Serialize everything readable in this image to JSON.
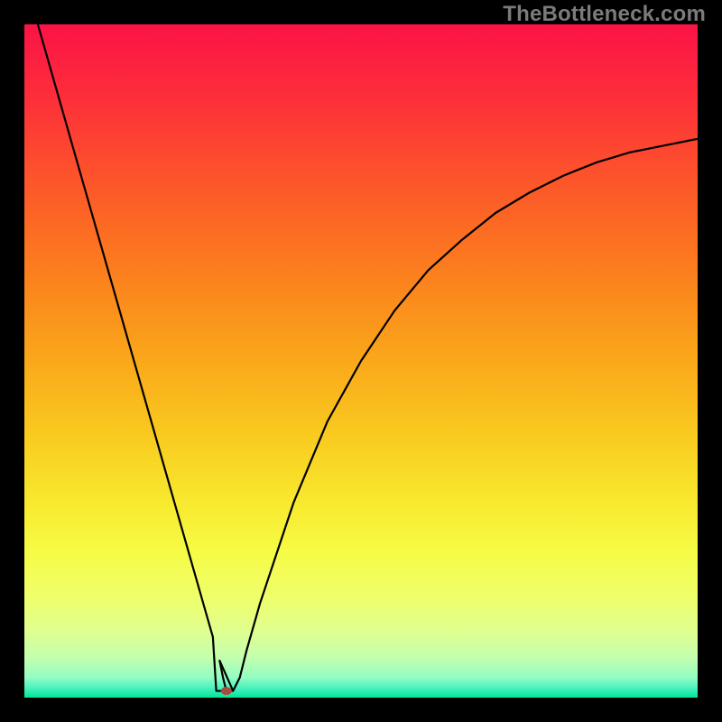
{
  "watermark": "TheBottleneck.com",
  "chart_data": {
    "type": "line",
    "title": "",
    "xlabel": "",
    "ylabel": "",
    "xlim": [
      0,
      100
    ],
    "ylim": [
      0,
      100
    ],
    "series": [
      {
        "name": "curve",
        "x": [
          2,
          5,
          10,
          15,
          20,
          25,
          27,
          28,
          29,
          29.5,
          30,
          31,
          32,
          33,
          35,
          40,
          45,
          50,
          55,
          60,
          65,
          70,
          75,
          80,
          85,
          90,
          95,
          100
        ],
        "y": [
          100,
          89.5,
          72,
          54.5,
          37,
          19.5,
          12.5,
          9,
          5.5,
          3,
          1,
          1,
          3,
          7,
          14,
          29,
          41,
          50,
          57.5,
          63.5,
          68,
          72,
          75,
          77.5,
          79.5,
          81,
          82,
          83
        ]
      }
    ],
    "marker": {
      "x": 30,
      "y": 1,
      "color": "#a84c3e"
    },
    "flat_segment": {
      "x_from": 28.5,
      "x_to": 31,
      "y": 1
    },
    "gradient_stops": [
      {
        "offset": 0.0,
        "color": "#fc1346"
      },
      {
        "offset": 0.1,
        "color": "#fd2c3b"
      },
      {
        "offset": 0.2,
        "color": "#fd4b2e"
      },
      {
        "offset": 0.3,
        "color": "#fc6a23"
      },
      {
        "offset": 0.4,
        "color": "#fb891c"
      },
      {
        "offset": 0.5,
        "color": "#faa81a"
      },
      {
        "offset": 0.6,
        "color": "#f9c71e"
      },
      {
        "offset": 0.7,
        "color": "#f8e62c"
      },
      {
        "offset": 0.78,
        "color": "#f6fb43"
      },
      {
        "offset": 0.85,
        "color": "#efff6b"
      },
      {
        "offset": 0.9,
        "color": "#e0ff8e"
      },
      {
        "offset": 0.94,
        "color": "#c4ffae"
      },
      {
        "offset": 0.97,
        "color": "#93fdc2"
      },
      {
        "offset": 0.985,
        "color": "#4df2c0"
      },
      {
        "offset": 1.0,
        "color": "#00e598"
      }
    ]
  }
}
